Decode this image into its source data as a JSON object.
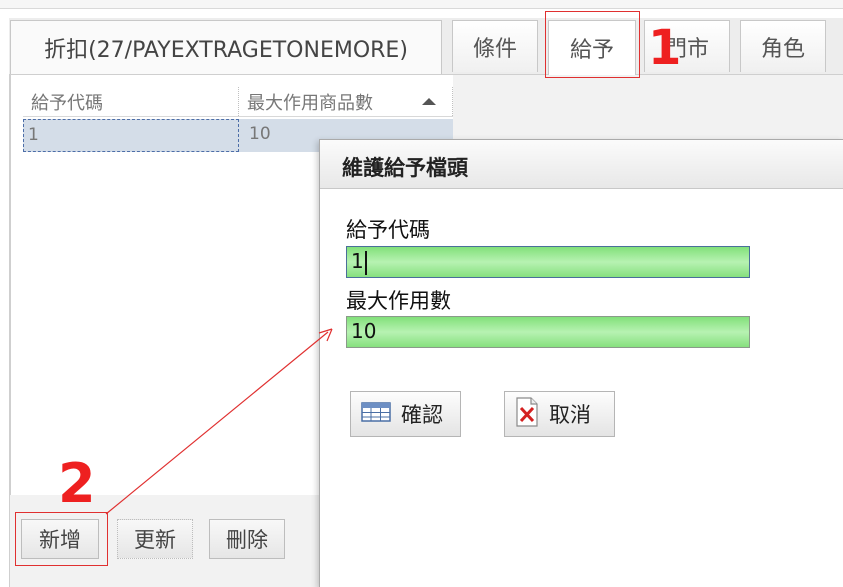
{
  "tabs": [
    {
      "label": "折扣(27/PAYEXTRAGETONEMORE)"
    },
    {
      "label": "條件"
    },
    {
      "label": "給予"
    },
    {
      "label": "門市"
    },
    {
      "label": "角色"
    }
  ],
  "grid": {
    "headers": [
      "給予代碼",
      "最大作用商品數"
    ],
    "rows": [
      {
        "code": "1",
        "max": "10"
      }
    ]
  },
  "bottom_buttons": {
    "add": "新增",
    "update": "更新",
    "delete": "刪除"
  },
  "annotations": {
    "marker_1": "1",
    "marker_2": "2"
  },
  "dialog": {
    "title": "維護給予檔頭",
    "code_label": "給予代碼",
    "code_value": "1",
    "max_label": "最大作用數",
    "max_value": "10",
    "confirm_label": "確認",
    "cancel_label": "取消"
  },
  "colors": {
    "annotation_red": "#e03030",
    "field_green": "#8ee488",
    "selected_row": "#d4dde8"
  },
  "icons": {
    "confirm": "table-icon",
    "cancel": "document-x-icon"
  }
}
